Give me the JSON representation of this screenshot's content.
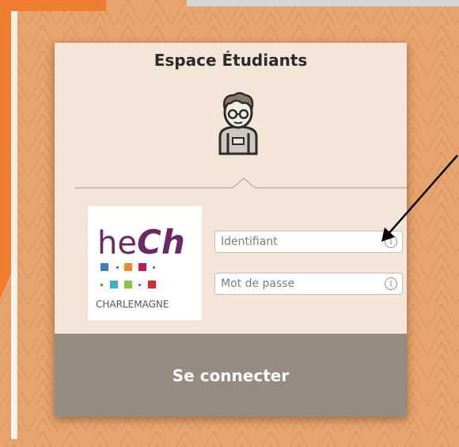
{
  "login": {
    "title": "Espace Étudiants",
    "avatar_icon": "student-avatar-icon",
    "logo": {
      "brand_prefix": "he",
      "brand_suffix": "Ch",
      "school_name": "CHARLEMAGNE"
    },
    "username": {
      "placeholder": "Identifiant",
      "info_icon": "info-icon"
    },
    "password": {
      "placeholder": "Mot de passe",
      "info_icon": "info-icon"
    },
    "submit_label": "Se connecter"
  },
  "colors": {
    "background": "#e7a46e",
    "accent_orange": "#ee7d30",
    "panel": "#f3e6d8",
    "button": "#968b80",
    "logo_purple": "#6b2a63"
  },
  "annotation": {
    "arrow_icon": "annotation-arrow-icon"
  }
}
